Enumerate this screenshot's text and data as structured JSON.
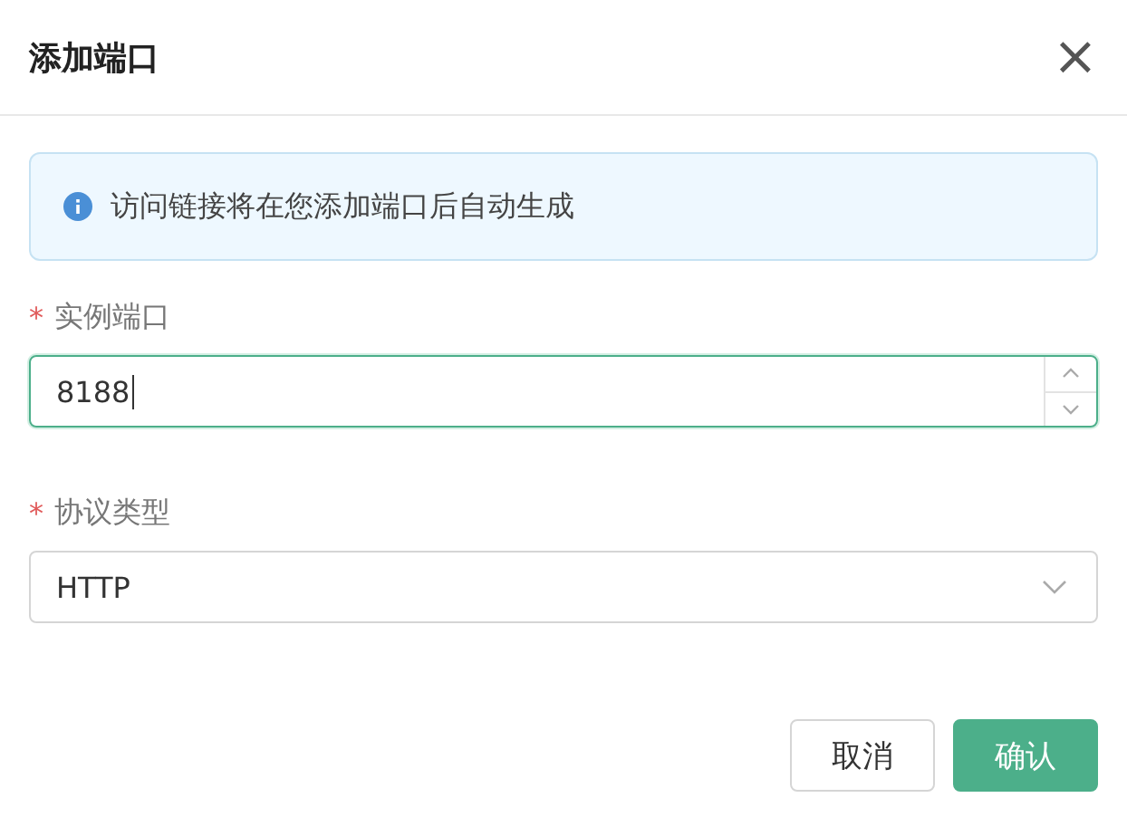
{
  "dialog": {
    "title": "添加端口",
    "close": "×"
  },
  "alert": {
    "text": "访问链接将在您添加端口后自动生成"
  },
  "fields": [
    {
      "kind": "number",
      "marker": "*",
      "label": "实例端口",
      "value": "8188",
      "focused": true
    },
    {
      "kind": "select",
      "marker": "*",
      "label": "协议类型",
      "value": "HTTP",
      "focused": false
    }
  ],
  "buttons": [
    {
      "label": "取消",
      "primary": false
    },
    {
      "label": "确认",
      "primary": true
    }
  ]
}
